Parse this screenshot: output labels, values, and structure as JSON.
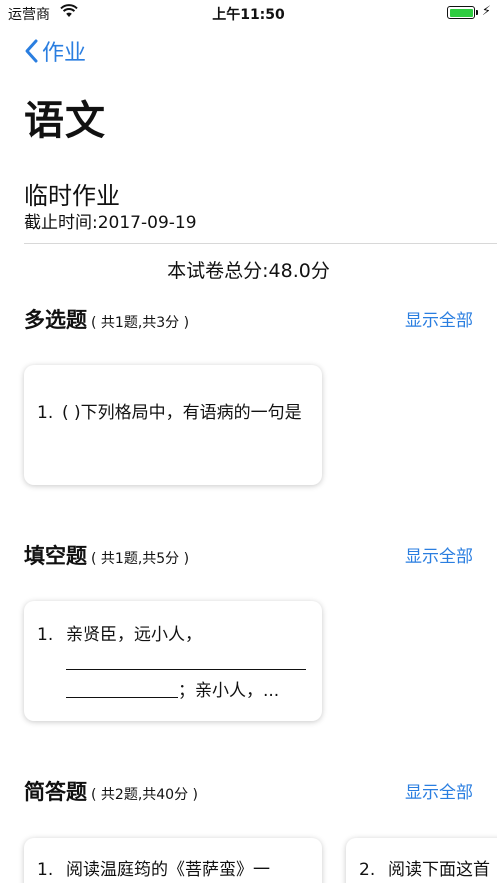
{
  "status_bar": {
    "carrier": "运营商",
    "time": "上午11:50"
  },
  "nav": {
    "back_label": "作业"
  },
  "subject_title": "语文",
  "homework": {
    "title": "临时作业",
    "deadline": "截止时间:2017-09-19",
    "total_score": "本试卷总分:48.0分"
  },
  "sections": [
    {
      "name": "多选题",
      "meta": "( 共1题,共3分 )",
      "show_all": "显示全部",
      "cards": [
        {
          "num": "1.",
          "text": "( )下列格局中，有语病的一句是"
        }
      ]
    },
    {
      "name": "填空题",
      "meta": "( 共1题,共5分 )",
      "show_all": "显示全部",
      "cards": [
        {
          "num": "1.",
          "line1": "亲贤臣，远小人，",
          "line3": "；亲小人，..."
        }
      ]
    },
    {
      "name": "简答题",
      "meta": "( 共2题,共40分 )",
      "show_all": "显示全部",
      "cards": [
        {
          "num": "1.",
          "text": "阅读温庭筠的《菩萨蛮》一"
        },
        {
          "num": "2.",
          "text": "阅读下面这首"
        }
      ]
    }
  ],
  "colors": {
    "accent": "#2a7ee0",
    "battery": "#2ecc40"
  },
  "icons": [
    "wifi-icon",
    "battery-icon",
    "charging-bolt-icon",
    "chevron-left-icon"
  ]
}
